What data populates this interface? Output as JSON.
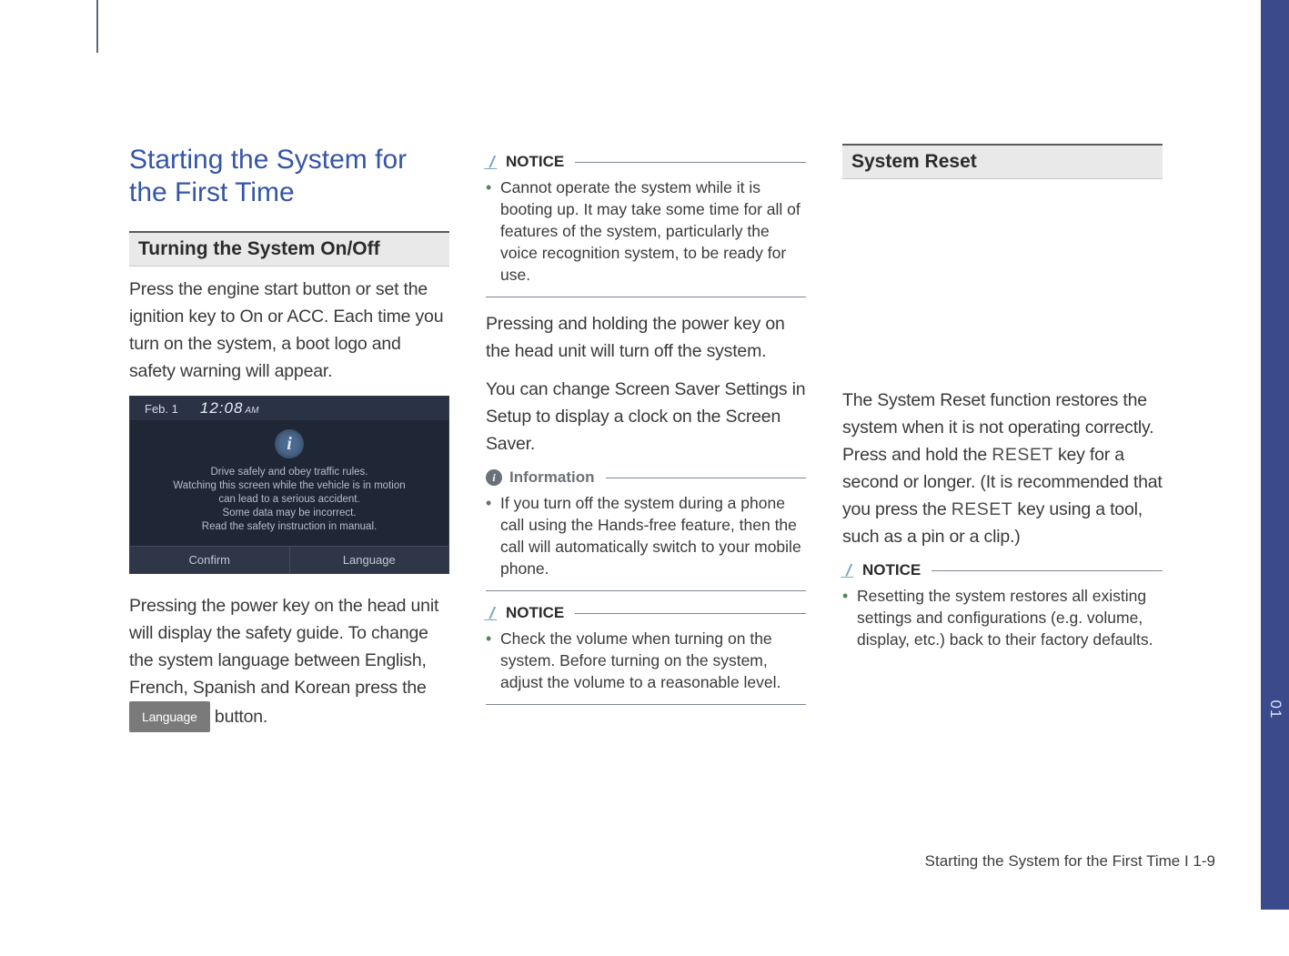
{
  "sideTab": {
    "chapter": "01"
  },
  "col1": {
    "mainTitle": "Starting the System for the First Time",
    "section1Head": "Turning the System On/Off",
    "p1": "Press the engine start button or set the ignition key to On or ACC. Each time you turn on the system, a boot logo and safety warning will appear.",
    "screenshot": {
      "date": "Feb. 1",
      "time": "12:08",
      "ampm": "AM",
      "msg1": "Drive safely and obey traffic rules.",
      "msg2": "Watching this screen while the vehicle is in motion",
      "msg3": "can lead to a serious accident.",
      "msg4": "Some data may be incorrect.",
      "msg5": "Read the safety instruction in manual.",
      "btnConfirm": "Confirm",
      "btnLanguage": "Language"
    },
    "p2a": "Pressing the power key on the head unit will display the safety guide. To change the system language between English, French, Spanish and Korean press the ",
    "langKey": "Language",
    "p2b": " button."
  },
  "col2": {
    "notice1Head": "NOTICE",
    "notice1Item": "Cannot operate the system while it is booting up. It may take some time for all of features of the system, particularly the voice recognition system, to be ready for use.",
    "p1": "Pressing and holding the power key on the head unit will turn off the system.",
    "p2": "You can change Screen Saver Settings in Setup to display a clock on the Screen Saver.",
    "infoHead": "Information",
    "infoItem": "If you turn off the system during a phone call using the Hands-free feature, then the call will automatically switch to your mobile phone.",
    "notice2Head": "NOTICE",
    "notice2Item": "Check the volume when turning on the system. Before turning on the system, adjust the volume to a reasonable level."
  },
  "col3": {
    "sectionHead": "System Reset",
    "p1a": "The System Reset function restores the system when it is not operating correctly. Press and hold the ",
    "reset1": "RESET",
    "p1b": " key for a second or longer. (It is recommended that you press the ",
    "reset2": "RESET",
    "p1c": " key using a tool, such as a pin or a clip.)",
    "noticeHead": "NOTICE",
    "noticeItem": "Resetting the system restores all existing settings and configurations (e.g. volume, display, etc.) back to their factory defaults."
  },
  "footer": "Starting the System for the First Time I 1-9"
}
